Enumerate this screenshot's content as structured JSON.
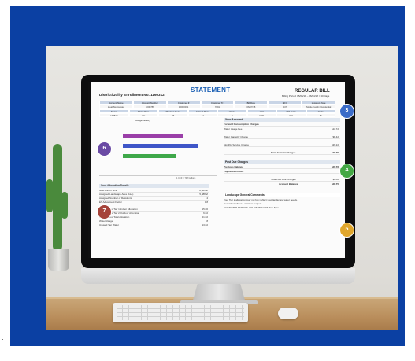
{
  "statement": {
    "title": "STATEMENT",
    "bill_type": "REGULAR BILL",
    "enrollment": "District/Utility Enrollment No. 1160312",
    "billing_period": "Billing Period: 05/05/18 – 06/04/18 = 30 Days",
    "header_cols": [
      "Account Name",
      "Account Number",
      "Customer #",
      "Customer Tr.",
      "Bill Date",
      "Bill #",
      "Location Zone"
    ],
    "header_vals": [
      "Ideal Stormwater",
      "1000786",
      "10000031",
      "7891",
      "06/07/18",
      "447",
      "Single Family Residential"
    ],
    "meter_cols": [
      "Meter",
      "Meter Type",
      "Previous Read",
      "Current Read",
      "Usage",
      "Unit",
      "CIS Cycle",
      "Cycle"
    ],
    "meter_vals": [
      "178840",
      "GF",
      "36",
      "44",
      "8",
      "GPS",
      "021",
      "Bi"
    ],
    "chart_title": "Usage History",
    "panel_summary": "Your Account",
    "forward_consumption": "Forward Consumption Charges",
    "row1": "Water Usage Fee",
    "row1v": "$11.72",
    "row2": "Water Capacity Charge",
    "row2v": "$8.42",
    "row3": "Monthly Service Charge",
    "row3v": "$36.22",
    "row4": "Total Current Charges",
    "row4v": "$48.75",
    "past_due": "Past Due Charges",
    "prev_balance": "Previous Balance",
    "prev_balance_v": "$46.76",
    "payments": "Payments/Credits",
    "total_past_due": "Total Past Due Charges",
    "total_past_due_v": "$0.00",
    "amount_due": "Account Balance",
    "amount_due_v": "$48.75",
    "left_section": "Your Allocation Details",
    "left_rows": [
      "Gold Ranch Size",
      "Assigned Landscape Area (ALA)",
      "Assigned Number of Residents",
      "ET Adjustment Factor"
    ],
    "left_vals": [
      "8,601 sf",
      "5,488 sf",
      "4",
      "0.8"
    ],
    "billing_period_rows": [
      "Billing Period Tier 1 Indoor Allocation",
      "Billing Period Tier 2 Outdoor Allocation",
      "Billing Period Total Allocation",
      "Water Usage",
      "Unused Tier Water"
    ],
    "billing_period_vals": [
      "15.00",
      "6.02",
      "21.02",
      "8",
      "13.02"
    ],
    "landscape_title": "Landscape General Comments",
    "landscape_lines": [
      "Your Tier 2 allocation may not fully reflect your landscape water needs.",
      "Contact us about a variance request.",
      "CUSTOMER SERVICE HOURS MON-FRI 8am-5pm"
    ],
    "chart_note": "1 CCF = 748 Gallons"
  },
  "badges": [
    {
      "id": "3",
      "color": "#3b6cc8"
    },
    {
      "id": "4",
      "color": "#44a844"
    },
    {
      "id": "5",
      "color": "#e0a62b"
    },
    {
      "id": "6",
      "color": "#6a4aa4"
    },
    {
      "id": "7",
      "color": "#a5433a"
    }
  ],
  "chart_data": {
    "type": "bar",
    "orientation": "horizontal",
    "title": "Usage History",
    "categories": [
      "",
      "",
      ""
    ],
    "values": [
      24,
      30,
      21
    ],
    "colors": [
      "#9a3fa8",
      "#3f56c8",
      "#3fa84a"
    ],
    "xlim": [
      0,
      34
    ]
  }
}
